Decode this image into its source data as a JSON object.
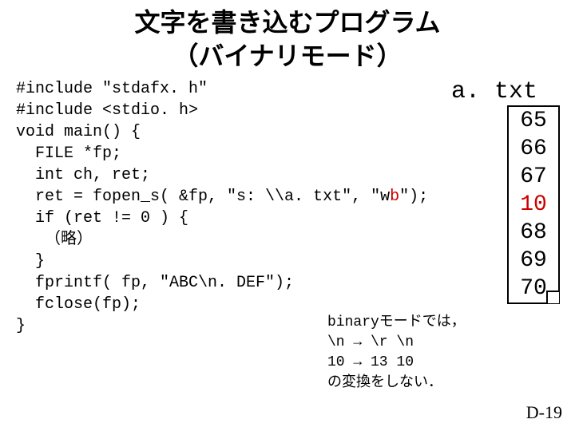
{
  "title_line1": "文字を書き込むプログラム",
  "title_line2": "（バイナリモード）",
  "code": {
    "l1a": "#include \"stdafx. h\"",
    "l2a": "#include <stdio. h>",
    "l3a": "void main() {",
    "l4a": "  FILE *fp;",
    "l5a": "  int ch, ret;",
    "l6a": "  ret = fopen_s( &fp, \"s: \\\\a. txt\", \"w",
    "l6b": "b",
    "l6c": "\");",
    "l7a": "  if (ret != 0 ) {",
    "l8a": "   （略）",
    "l9a": "  }",
    "l10a": "  fprintf( fp, \"ABC\\n. DEF\");",
    "l11a": "  fclose(fp);",
    "l12a": "}"
  },
  "note": {
    "l1": "binaryモードでは，",
    "l2": "\\n → \\r \\n",
    "l3": "10 → 13 10",
    "l4": "の変換をしない．"
  },
  "file_label": "a. txt",
  "file_values": [
    "65",
    "66",
    "67",
    "10",
    "68",
    "69",
    "70"
  ],
  "file_red_index": 3,
  "page_number": "D-19"
}
